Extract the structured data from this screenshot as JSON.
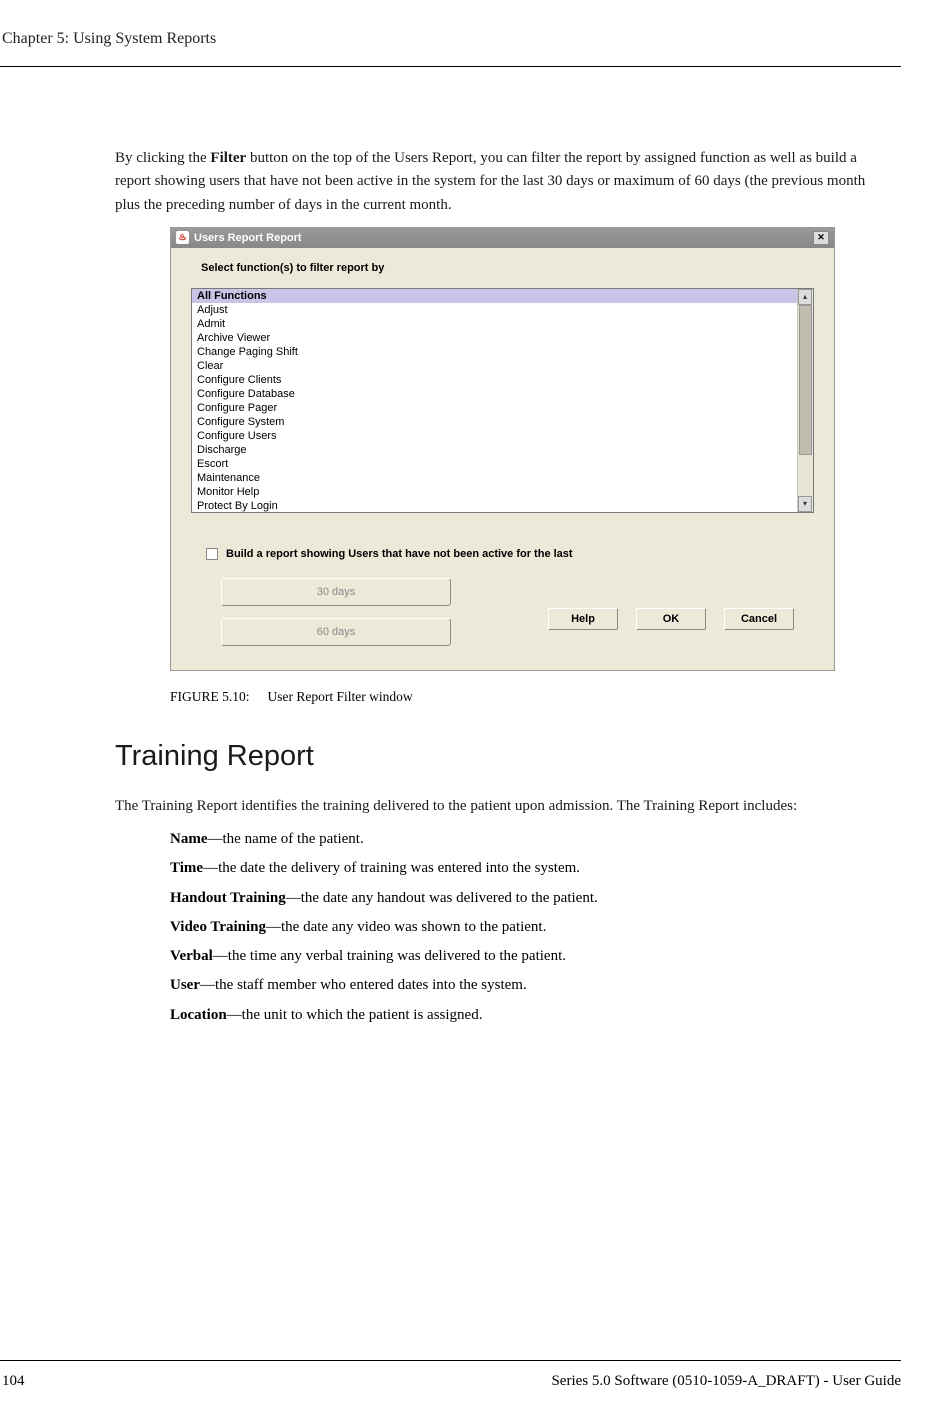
{
  "header": {
    "chapter": "Chapter 5: Using System Reports"
  },
  "intro_text": {
    "prefix": "By clicking the ",
    "bold1": "Filter",
    "rest": " button on the top of the Users Report, you can filter the report by assigned function as well as build a report showing users that have not been active in the system for the last 30 days or maximum of 60 days (the previous month plus the preceding number of days in the current month."
  },
  "dialog": {
    "title": "Users Report Report",
    "filter_label": "Select function(s) to filter report by",
    "functions": [
      "All Functions",
      "Adjust",
      "Admit",
      "Archive Viewer",
      "Change Paging Shift",
      "Clear",
      "Configure Clients",
      "Configure Database",
      "Configure Pager",
      "Configure System",
      "Configure Users",
      "Discharge",
      "Escort",
      "Maintenance",
      "Monitor Help",
      "Protect By Login"
    ],
    "checkbox_label": "Build a report showing Users that have not been active for the last",
    "btn_30": "30 days",
    "btn_60": "60 days",
    "help": "Help",
    "ok": "OK",
    "cancel": "Cancel"
  },
  "figure": {
    "num": "FIGURE 5.10:",
    "caption": "User Report Filter window"
  },
  "section": {
    "heading": "Training Report",
    "intro": "The Training Report identifies the training delivered to the patient upon admission. The Training Report includes:",
    "items": [
      {
        "term": "Name",
        "desc": "—the name of the patient."
      },
      {
        "term": "Time",
        "desc": "—the date the delivery of training was entered into the system."
      },
      {
        "term": "Handout Training",
        "desc": "—the date any handout was delivered to the patient."
      },
      {
        "term": "Video Training",
        "desc": "—the date any video was shown to the patient."
      },
      {
        "term": "Verbal",
        "desc": "—the time any verbal training was delivered to the patient."
      },
      {
        "term": "User",
        "desc": "—the staff member who entered dates into the system."
      },
      {
        "term": "Location",
        "desc": "—the unit to which the patient is assigned."
      }
    ]
  },
  "footer": {
    "page": "104",
    "doc": "Series 5.0 Software (0510-1059-A_DRAFT) - User Guide"
  }
}
